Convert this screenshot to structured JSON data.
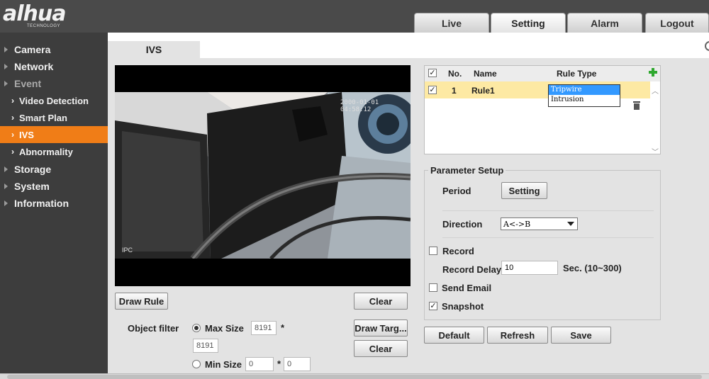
{
  "brand": {
    "logo_text": "alhua",
    "logo_sub": "TECHNOLOGY"
  },
  "top_tabs": [
    {
      "label": "Live"
    },
    {
      "label": "Setting",
      "active": true
    },
    {
      "label": "Alarm"
    },
    {
      "label": "Logout"
    }
  ],
  "sidebar": {
    "items": [
      {
        "label": "Camera"
      },
      {
        "label": "Network"
      },
      {
        "label": "Event"
      },
      {
        "label": "Video Detection"
      },
      {
        "label": "Smart Plan"
      },
      {
        "label": "IVS",
        "active": true
      },
      {
        "label": "Abnormality"
      },
      {
        "label": "Storage"
      },
      {
        "label": "System"
      },
      {
        "label": "Information"
      }
    ]
  },
  "page": {
    "tab": "IVS"
  },
  "video": {
    "timestamp": "2000-01-01 04:58:12",
    "channel_label": "IPC"
  },
  "controls": {
    "draw_rule": "Draw Rule",
    "clear_rule": "Clear",
    "draw_target": "Draw Targ...",
    "clear_target": "Clear",
    "object_filter_label": "Object filter",
    "max_size_label": "Max Size",
    "max_w": "8191",
    "max_h": "8191",
    "min_size_label": "Min Size",
    "min_w": "0",
    "min_h": "0",
    "times": "*"
  },
  "rule_table": {
    "headers": {
      "no": "No.",
      "name": "Name",
      "type": "Rule Type"
    },
    "rows": [
      {
        "no": "1",
        "name": "Rule1"
      }
    ],
    "type_options": [
      "Tripwire",
      "Intrusion"
    ],
    "selected_type": "Tripwire"
  },
  "params": {
    "title": "Parameter Setup",
    "period_label": "Period",
    "period_button": "Setting",
    "direction_label": "Direction",
    "direction_value": "A<->B",
    "record_label": "Record",
    "record_checked": false,
    "record_delay_label": "Record Delay",
    "record_delay_value": "10",
    "record_delay_unit": "Sec. (10~300)",
    "send_email_label": "Send Email",
    "send_email_checked": false,
    "snapshot_label": "Snapshot",
    "snapshot_checked": true
  },
  "actions": {
    "default": "Default",
    "refresh": "Refresh",
    "save": "Save"
  },
  "colors": {
    "accent": "#f07d17",
    "sidebar_bg": "#3d3d3d",
    "header_bg": "#4a4a4a",
    "row_highlight": "#fde9a3"
  }
}
